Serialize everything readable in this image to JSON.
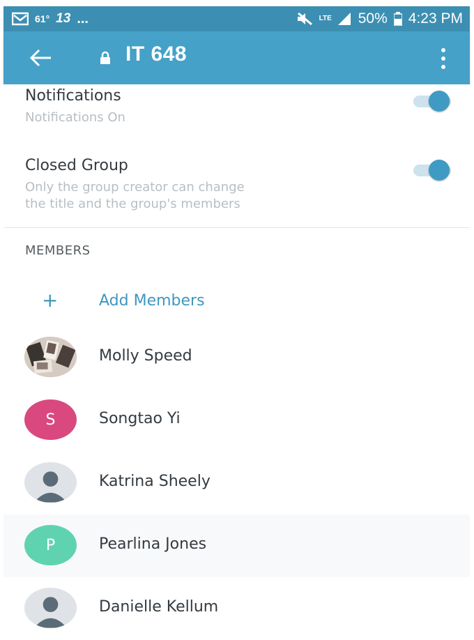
{
  "status_bar": {
    "temperature": "61°",
    "notification_count": "13",
    "more": "...",
    "network": "LTE",
    "battery": "50%",
    "time": "4:23 PM"
  },
  "app_bar": {
    "title": "IT 648",
    "icons": [
      "back-arrow-icon",
      "lock-icon",
      "more-vert-icon"
    ]
  },
  "settings": {
    "notifications": {
      "title": "Notifications",
      "subtitle": "Notifications On",
      "enabled": true
    },
    "closed_group": {
      "title": "Closed Group",
      "subtitle_line1": "Only the group creator can change",
      "subtitle_line2": "the title and the group's members",
      "enabled": true
    }
  },
  "members_section": {
    "header": "MEMBERS",
    "add_label": "Add Members",
    "add_icon": "+",
    "members": [
      {
        "name": "Molly Speed",
        "avatar": "photo"
      },
      {
        "name": "Songtao Yi",
        "avatar": "initial",
        "initial": "S",
        "color": "#d9497f"
      },
      {
        "name": "Katrina Sheely",
        "avatar": "placeholder"
      },
      {
        "name": "Pearlina Jones",
        "avatar": "initial",
        "initial": "P",
        "color": "#5fd3b0"
      },
      {
        "name": "Danielle Kellum",
        "avatar": "placeholder"
      }
    ]
  },
  "colors": {
    "status_bar": "#3c8fb2",
    "app_bar": "#45a1c8",
    "accent": "#3f97bf"
  }
}
